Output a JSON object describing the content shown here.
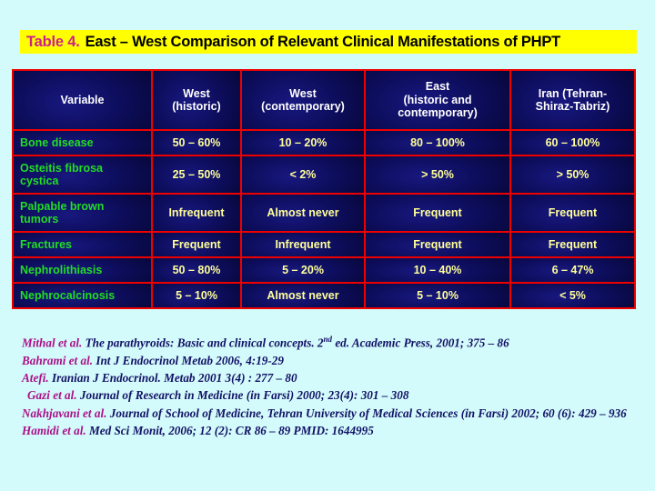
{
  "background_color": "#d4fbfb",
  "title": {
    "label_number": "Table 4.",
    "label_text": "East – West Comparison of Relevant Clinical Manifestations of PHPT",
    "highlight_color": "#ffff00",
    "number_color": "#cc2288",
    "text_color": "#000000"
  },
  "table": {
    "border_color": "#ee0000",
    "cell_background": "#0b0b52",
    "header_text_color": "#ffffff",
    "rowlabel_color": "#22dd22",
    "value_color": "#ffff99",
    "headers": [
      "Variable",
      "West (historic)",
      "West (contemporary)",
      "East (historic and contemporary)",
      "Iran (Tehran-Shiraz-Tabriz)"
    ],
    "headers_lines": [
      [
        "Variable"
      ],
      [
        "West",
        "(historic)"
      ],
      [
        "West",
        "(contemporary)"
      ],
      [
        "East",
        "(historic and",
        "contemporary)"
      ],
      [
        "Iran (Tehran-",
        "Shiraz-Tabriz)"
      ]
    ],
    "rows": [
      {
        "variable": "Bone disease",
        "variable_lines": [
          "Bone disease"
        ],
        "west_historic": "50 – 60%",
        "west_contemporary": "10 – 20%",
        "east": "80 – 100%",
        "iran": "60 – 100%",
        "tall": false
      },
      {
        "variable": "Osteitis fibrosa cystica",
        "variable_lines": [
          "Osteitis fibrosa",
          "cystica"
        ],
        "west_historic": "25 – 50%",
        "west_contemporary": "< 2%",
        "east": "> 50%",
        "iran": "> 50%",
        "tall": true
      },
      {
        "variable": "Palpable brown tumors",
        "variable_lines": [
          "Palpable brown",
          "tumors"
        ],
        "west_historic": "Infrequent",
        "west_contemporary": "Almost never",
        "east": "Frequent",
        "iran": "Frequent",
        "tall": true
      },
      {
        "variable": "Fractures",
        "variable_lines": [
          "Fractures"
        ],
        "west_historic": "Frequent",
        "west_contemporary": "Infrequent",
        "east": "Frequent",
        "iran": "Frequent",
        "tall": false
      },
      {
        "variable": "Nephrolithiasis",
        "variable_lines": [
          "Nephrolithiasis"
        ],
        "west_historic": "50 – 80%",
        "west_contemporary": "5 – 20%",
        "east": "10 – 40%",
        "iran": "6 – 47%",
        "tall": false
      },
      {
        "variable": "Nephrocalcinosis",
        "variable_lines": [
          "Nephrocalcinosis"
        ],
        "west_historic": "5 – 10%",
        "west_contemporary": "Almost never",
        "east": "5 – 10%",
        "iran": "< 5%",
        "tall": false
      }
    ]
  },
  "references": {
    "author_color": "#aa1188",
    "body_color": "#111166",
    "items": [
      {
        "author": "Mithal et al.",
        "citation_pre": " The parathyroids: Basic and clinical concepts. 2",
        "superscript": "nd",
        "citation_post": " ed. Academic Press, 2001; 375 – 86",
        "indent": false
      },
      {
        "author": "Bahrami et al.",
        "citation_pre": " Int J Endocrinol Metab 2006,  4:19-29",
        "superscript": "",
        "citation_post": "",
        "indent": false
      },
      {
        "author": "Atefi.",
        "citation_pre": " Iranian J Endocrinol. Metab 2001 3(4) : 277 – 80",
        "superscript": "",
        "citation_post": "",
        "indent": false
      },
      {
        "author": "Gazi et al.",
        "citation_pre": " Journal of Research in Medicine (in Farsi) 2000; 23(4): 301 – 308",
        "superscript": "",
        "citation_post": "",
        "indent": true
      },
      {
        "author": "Nakhjavani et al.",
        "citation_pre": " Journal of School of Medicine, Tehran University of Medical Sciences (in Farsi) 2002; 60 (6): 429 – 936",
        "superscript": "",
        "citation_post": "",
        "indent": false
      },
      {
        "author": "Hamidi et al.",
        "citation_pre": " Med Sci Monit, 2006; 12 (2): CR 86 – 89 PMID: 1644995",
        "superscript": "",
        "citation_post": "",
        "indent": false
      }
    ]
  }
}
